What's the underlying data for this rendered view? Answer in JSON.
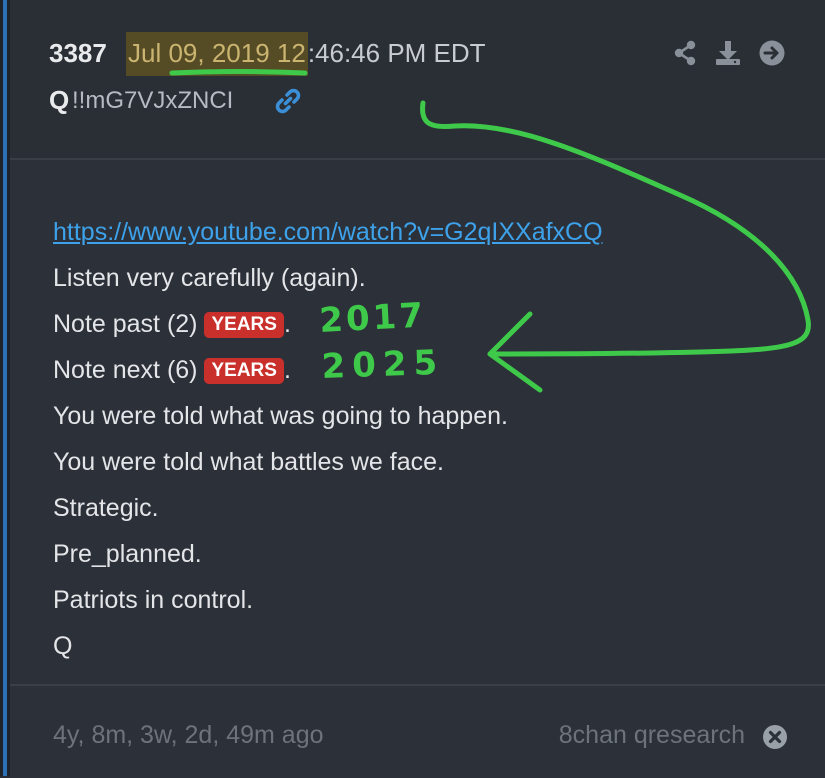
{
  "post": {
    "number": "3387",
    "timestamp_highlight": "Jul 09, 2019 12",
    "timestamp_rest": ":46:46 PM EDT",
    "author": "Q",
    "tripcode": "!!mG7VJxZNCI"
  },
  "header_icons": [
    "share-icon",
    "download-icon",
    "next-arrow-icon"
  ],
  "body": {
    "url": "https://www.youtube.com/watch?v=G2qIXXafxCQ",
    "line_listen": "Listen very carefully (again).",
    "line_past_prefix": "Note past (2)",
    "line_next_prefix": "Note next (6)",
    "badge": "YEARS",
    "dot": ".",
    "line_told_happen": "You were told what was going to happen.",
    "line_told_battles": "You were told what battles we face.",
    "line_strategic": "Strategic.",
    "line_preplanned": "Pre_planned.",
    "line_patriots": "Patriots in control.",
    "line_sign": "Q"
  },
  "annotations": {
    "year_past": "2017",
    "year_next": "2025",
    "ink_color": "#3ec94a"
  },
  "footer": {
    "age": "4y, 8m, 3w, 2d, 49m ago",
    "source": "8chan qresearch"
  },
  "colors": {
    "link": "#3da2ea",
    "badge": "#c9302c",
    "highlight": "#786619"
  }
}
